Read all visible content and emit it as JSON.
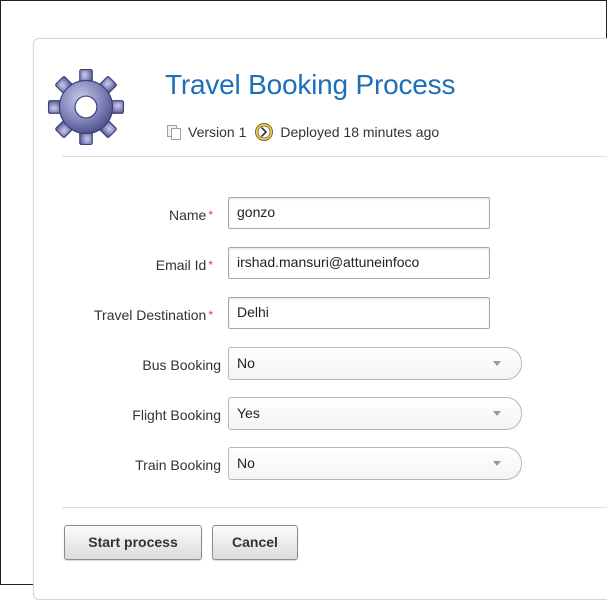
{
  "header": {
    "title": "Travel Booking Process",
    "version_text": "Version 1",
    "deployed_text": "Deployed 18 minutes ago",
    "icons": {
      "process": "gear-icon",
      "version": "version-copy-icon",
      "deployed": "clock-deploy-icon"
    }
  },
  "form": {
    "name": {
      "label": "Name",
      "required_mark": "*",
      "value": "gonzo"
    },
    "email": {
      "label": "Email Id",
      "required_mark": "*",
      "value": "irshad.mansuri@attuneinfoco"
    },
    "destination": {
      "label": "Travel Destination",
      "required_mark": "*",
      "value": "Delhi"
    },
    "bus_booking": {
      "label": "Bus Booking",
      "selected": "No"
    },
    "flight_booking": {
      "label": "Flight Booking",
      "selected": "Yes"
    },
    "train_booking": {
      "label": "Train Booking",
      "selected": "No"
    }
  },
  "actions": {
    "start_label": "Start process",
    "cancel_label": "Cancel"
  },
  "colors": {
    "title": "#1d6fb8",
    "required": "#e03a3a",
    "gear_fill": "#7d7fb3"
  }
}
